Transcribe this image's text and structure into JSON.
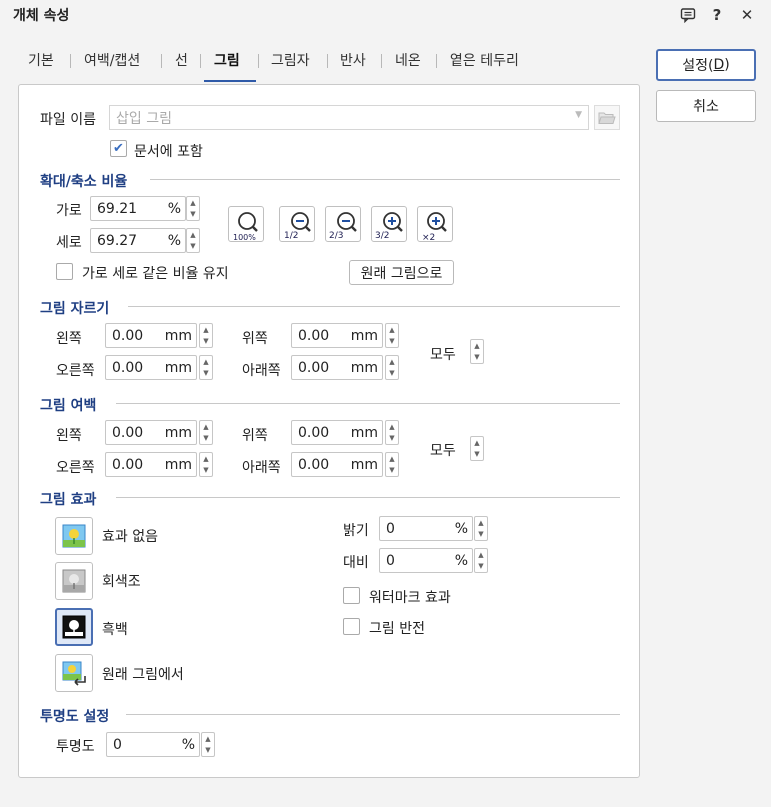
{
  "window": {
    "title": "개체 속성"
  },
  "titlebar_icons": [
    "comment-icon",
    "help-icon",
    "close-icon"
  ],
  "titlebar_glyphs": {
    "help": "?",
    "close": "✕"
  },
  "tabs": [
    {
      "label": "기본"
    },
    {
      "label": "여백/캡션"
    },
    {
      "label": "선"
    },
    {
      "label": "그림"
    },
    {
      "label": "그림자"
    },
    {
      "label": "반사"
    },
    {
      "label": "네온"
    },
    {
      "label": "옅은 테두리"
    }
  ],
  "active_tab": "그림",
  "buttons": {
    "ok": "설정(D)",
    "cancel": "취소"
  },
  "file": {
    "label": "파일 이름",
    "placeholder": "삽입 그림",
    "embed_label": "문서에 포함",
    "embed_checked": true
  },
  "scale": {
    "section": "확대/축소 비율",
    "horizontal_label": "가로",
    "horizontal_value": "69.21",
    "vertical_label": "세로",
    "vertical_value": "69.27",
    "unit": "%",
    "keep_ratio_label": "가로 세로 같은 비율 유지",
    "keep_ratio_checked": false,
    "original_button": "원래 그림으로",
    "zoom_buttons": [
      "zoom-100-icon",
      "zoom-half-icon",
      "zoom-two-thirds-icon",
      "zoom-three-halves-icon",
      "zoom-double-icon"
    ],
    "zoom_captions": [
      "100%",
      "1/2",
      "2/3",
      "3/2",
      "×2"
    ]
  },
  "crop": {
    "section": "그림 자르기",
    "left_label": "왼쪽",
    "left_value": "0.00",
    "top_label": "위쪽",
    "top_value": "0.00",
    "right_label": "오른쪽",
    "right_value": "0.00",
    "bottom_label": "아래쪽",
    "bottom_value": "0.00",
    "unit": "mm",
    "all_label": "모두"
  },
  "margin": {
    "section": "그림 여백",
    "left_label": "왼쪽",
    "left_value": "0.00",
    "top_label": "위쪽",
    "top_value": "0.00",
    "right_label": "오른쪽",
    "right_value": "0.00",
    "bottom_label": "아래쪽",
    "bottom_value": "0.00",
    "unit": "mm",
    "all_label": "모두"
  },
  "effect": {
    "section": "그림 효과",
    "options": [
      "효과 없음",
      "회색조",
      "흑백",
      "원래 그림에서"
    ],
    "selected": "흑백",
    "brightness_label": "밝기",
    "brightness_value": "0",
    "contrast_label": "대비",
    "contrast_value": "0",
    "unit": "%",
    "watermark_label": "워터마크 효과",
    "watermark_checked": false,
    "invert_label": "그림 반전",
    "invert_checked": false
  },
  "transparency": {
    "section": "투명도 설정",
    "label": "투명도",
    "value": "0",
    "unit": "%"
  },
  "colors": {
    "accent": "#2f5aa8",
    "section_title": "#1f3f83",
    "check": "#3a6ec0"
  }
}
